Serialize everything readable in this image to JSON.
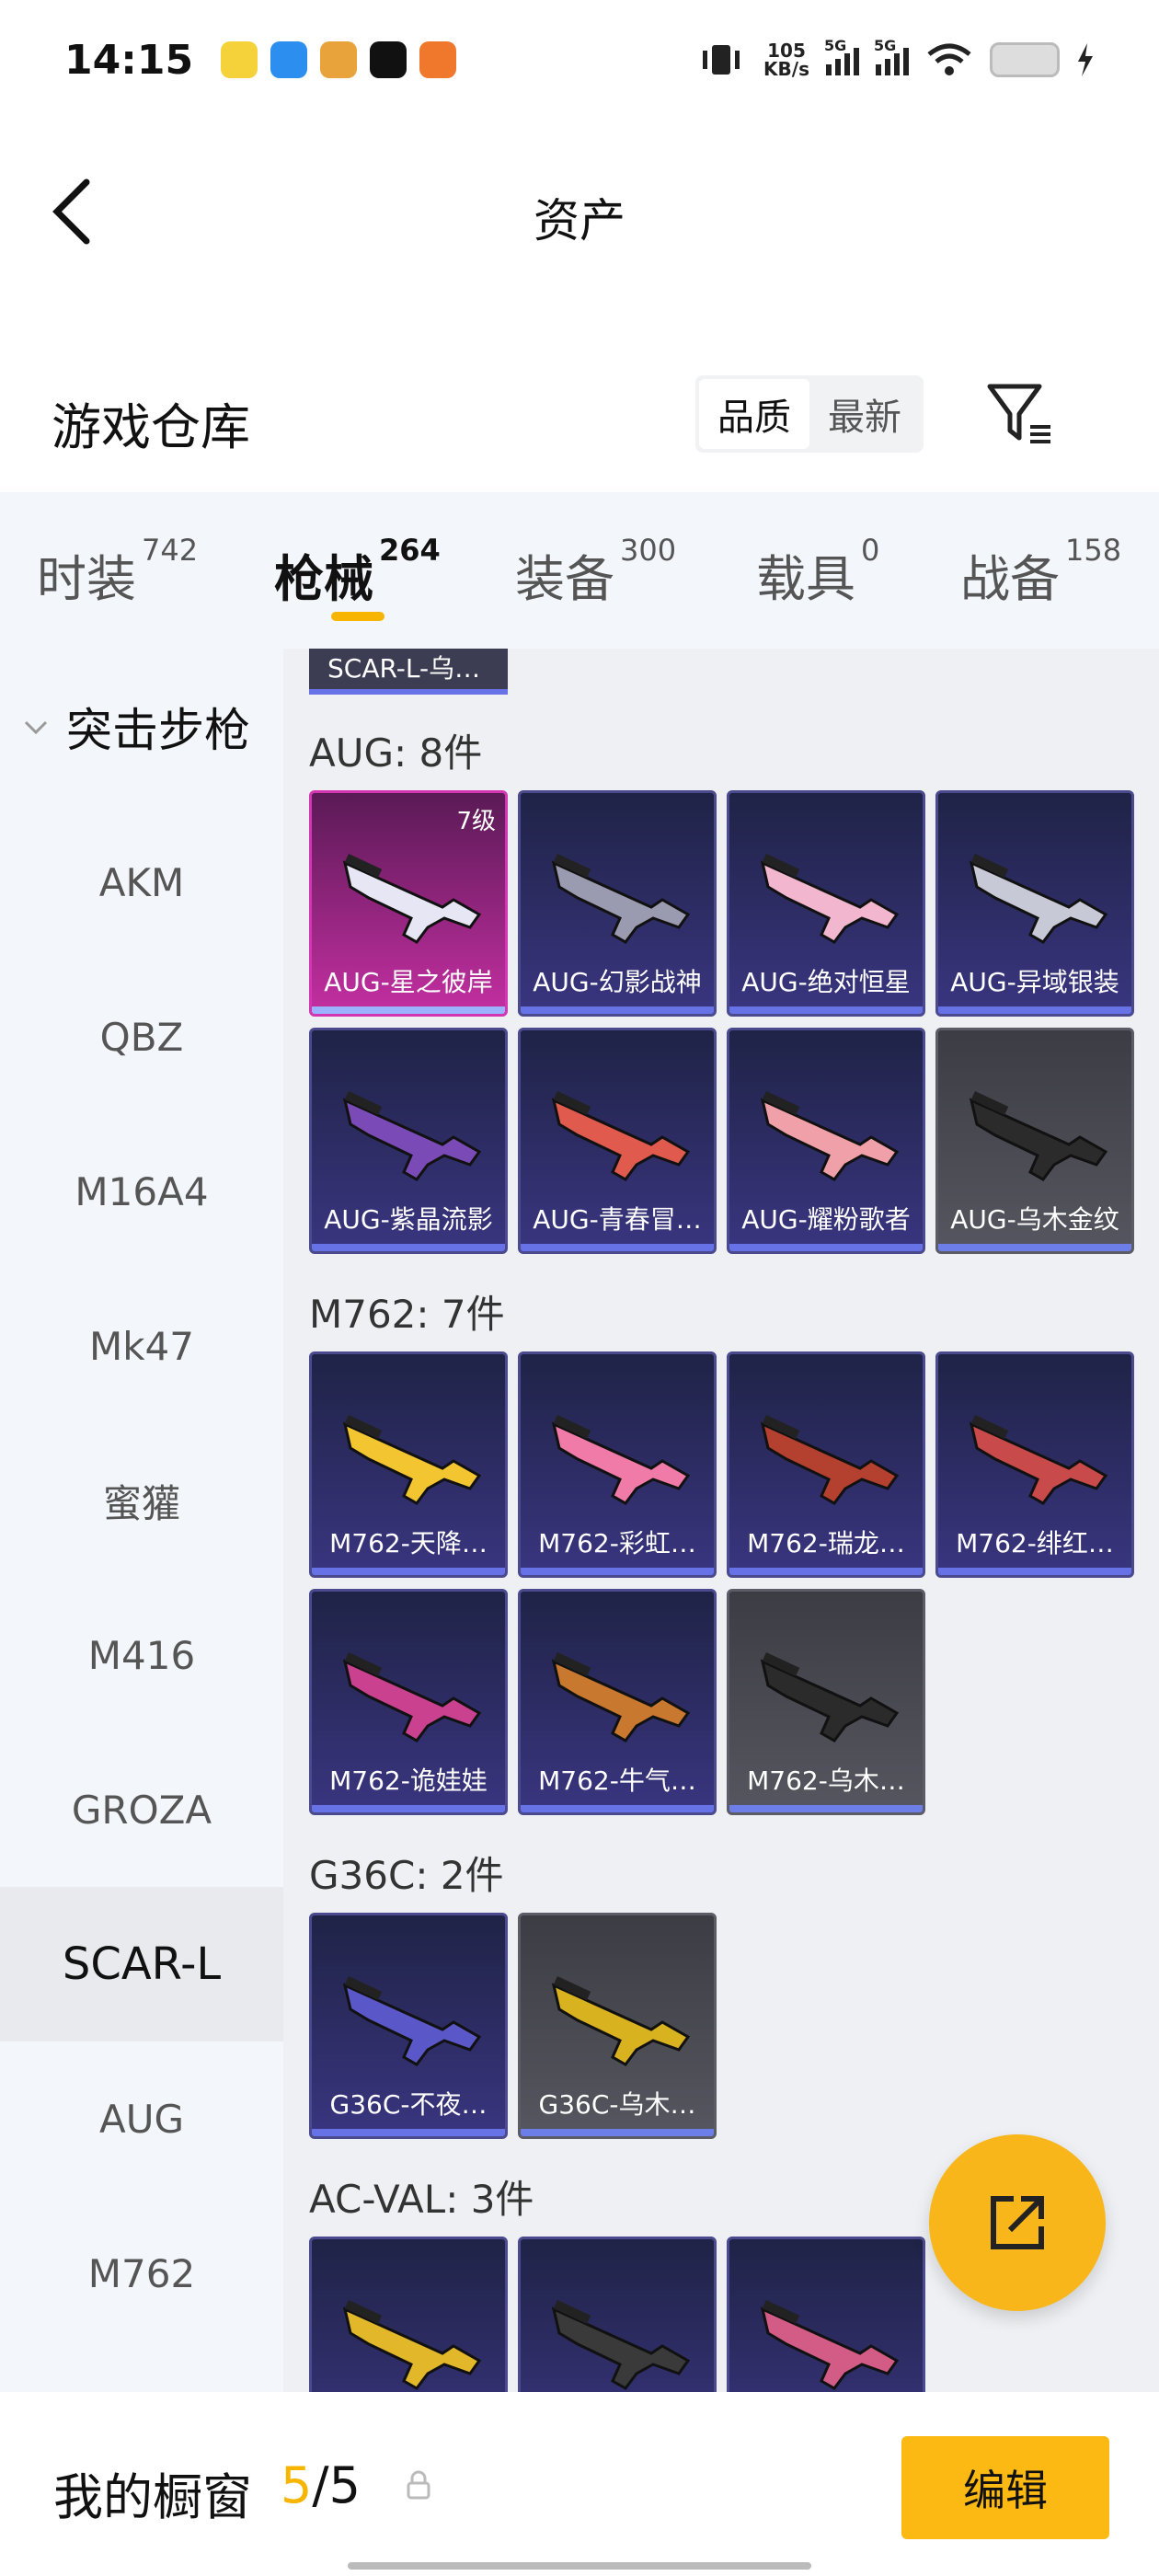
{
  "status": {
    "time": "14:15",
    "net_speed_top": "105",
    "net_speed_bottom": "KB/s",
    "sig1": "5G",
    "sig2": "5G"
  },
  "header": {
    "title": "资产"
  },
  "warehouse": {
    "title": "游戏仓库",
    "sort_quality": "品质",
    "sort_latest": "最新"
  },
  "tabs": [
    {
      "label": "时装",
      "count": "742"
    },
    {
      "label": "枪械",
      "count": "264"
    },
    {
      "label": "装备",
      "count": "300"
    },
    {
      "label": "载具",
      "count": "0"
    },
    {
      "label": "战备",
      "count": "158"
    }
  ],
  "sidebar": {
    "group": "突击步枪",
    "items": [
      "AKM",
      "QBZ",
      "M16A4",
      "Mk47",
      "蜜獾",
      "M416",
      "GROZA",
      "SCAR-L",
      "AUG",
      "M762"
    ]
  },
  "content": {
    "partial_top_label": "SCAR-L-乌…",
    "groups": [
      {
        "title": "AUG: 8件",
        "items": [
          {
            "label": "AUG-星之彼岸",
            "level": "7级",
            "style": "pink",
            "color": "#e6e6f5"
          },
          {
            "label": "AUG-幻影战神",
            "style": "dark",
            "color": "#9a9ab0"
          },
          {
            "label": "AUG-绝对恒星",
            "style": "dark",
            "color": "#f2b6cf"
          },
          {
            "label": "AUG-异域银装",
            "style": "dark",
            "color": "#c7c9d6"
          },
          {
            "label": "AUG-紫晶流影",
            "style": "dark",
            "color": "#7a4ab6"
          },
          {
            "label": "AUG-青春冒…",
            "style": "dark",
            "color": "#e05a4e"
          },
          {
            "label": "AUG-耀粉歌者",
            "style": "dark",
            "color": "#f0a0a8"
          },
          {
            "label": "AUG-乌木金纹",
            "style": "gray",
            "color": "#2b2b2b"
          }
        ]
      },
      {
        "title": "M762: 7件",
        "items": [
          {
            "label": "M762-天降…",
            "style": "dark",
            "color": "#f2c531"
          },
          {
            "label": "M762-彩虹…",
            "style": "dark",
            "color": "#f07aa8"
          },
          {
            "label": "M762-瑞龙…",
            "style": "dark",
            "color": "#b4402f"
          },
          {
            "label": "M762-绯红…",
            "style": "dark",
            "color": "#c84a4a"
          },
          {
            "label": "M762-诡娃娃",
            "style": "dark",
            "color": "#c9418f"
          },
          {
            "label": "M762-牛气…",
            "style": "dark",
            "color": "#c8782f"
          },
          {
            "label": "M762-乌木…",
            "style": "gray",
            "color": "#2b2b2b"
          }
        ]
      },
      {
        "title": "G36C: 2件",
        "items": [
          {
            "label": "G36C-不夜…",
            "style": "dark",
            "color": "#5a57c8"
          },
          {
            "label": "G36C-乌木…",
            "style": "gray",
            "color": "#d9b21f"
          }
        ]
      },
      {
        "title": "AC-VAL: 3件",
        "items": [
          {
            "label": "",
            "style": "dark",
            "color": "#e2b72a"
          },
          {
            "label": "",
            "style": "dark",
            "color": "#3a3a3a"
          },
          {
            "label": "",
            "style": "dark",
            "color": "#d35c86"
          }
        ]
      }
    ]
  },
  "bottom": {
    "label": "我的橱窗",
    "current": "5",
    "total": "5",
    "edit_label": "编辑"
  },
  "colors": {
    "accent": "#f7b500"
  }
}
